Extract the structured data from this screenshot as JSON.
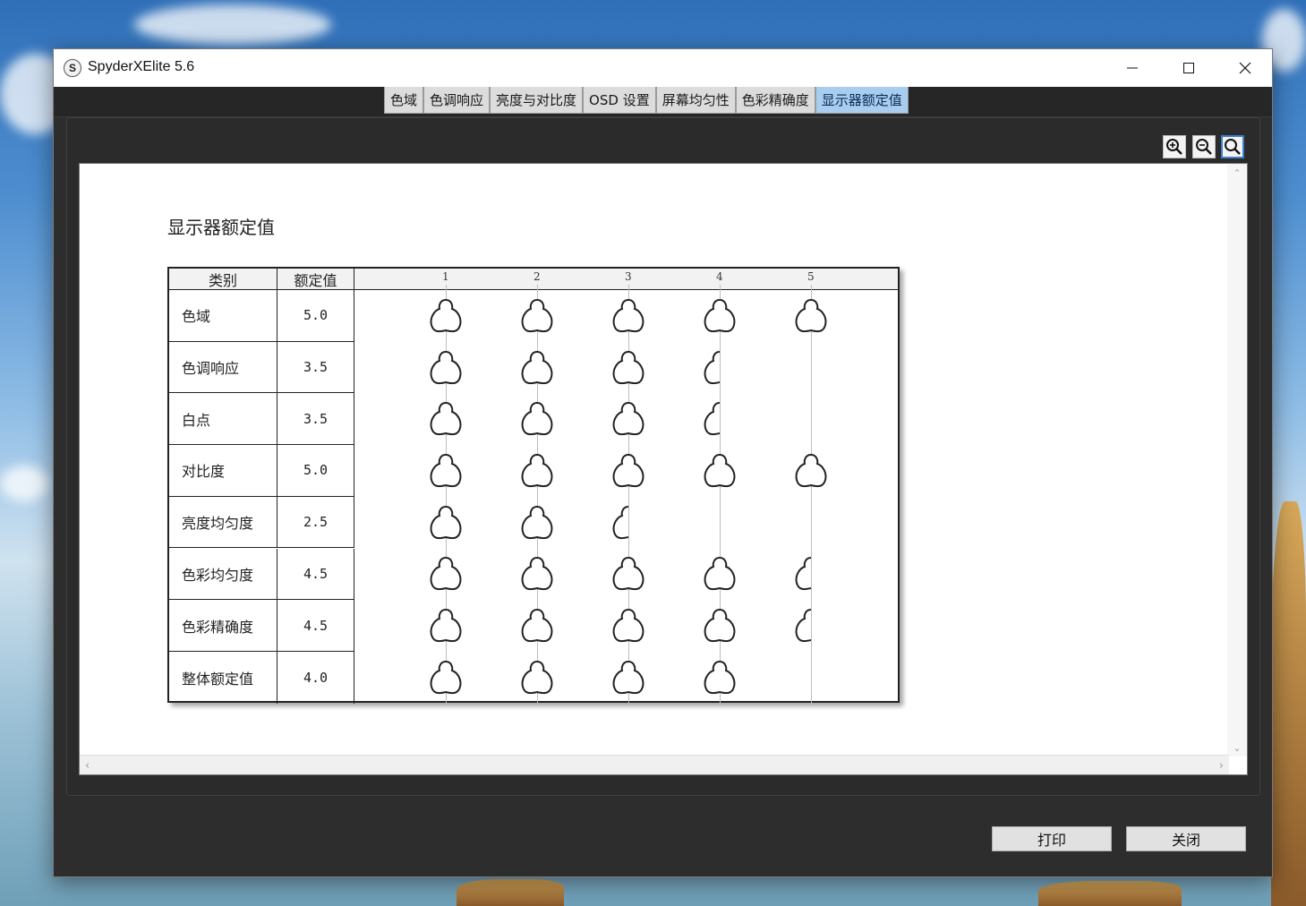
{
  "window": {
    "title": "SpyderXElite 5.6",
    "app_icon_letter": "S"
  },
  "tabs": [
    {
      "label": "色域",
      "active": false
    },
    {
      "label": "色调响应",
      "active": false
    },
    {
      "label": "亮度与对比度",
      "active": false
    },
    {
      "label": "OSD 设置",
      "active": false
    },
    {
      "label": "屏幕均匀性",
      "active": false
    },
    {
      "label": "色彩精确度",
      "active": false
    },
    {
      "label": "显示器额定值",
      "active": true
    }
  ],
  "zoom_tools": [
    "zoom-in-icon",
    "zoom-out-icon",
    "zoom-fit-icon"
  ],
  "report": {
    "title": "显示器额定值",
    "headers": {
      "category": "类别",
      "rating": "额定值",
      "scale": [
        "1",
        "2",
        "3",
        "4",
        "5"
      ]
    },
    "rows": [
      {
        "category": "色域",
        "rating": "5.0",
        "value": 5.0
      },
      {
        "category": "色调响应",
        "rating": "3.5",
        "value": 3.5
      },
      {
        "category": "白点",
        "rating": "3.5",
        "value": 3.5
      },
      {
        "category": "对比度",
        "rating": "5.0",
        "value": 5.0
      },
      {
        "category": "亮度均匀度",
        "rating": "2.5",
        "value": 2.5
      },
      {
        "category": "色彩均匀度",
        "rating": "4.5",
        "value": 4.5
      },
      {
        "category": "色彩精确度",
        "rating": "4.5",
        "value": 4.5
      },
      {
        "category": "整体额定值",
        "rating": "4.0",
        "value": 4.0
      }
    ]
  },
  "buttons": {
    "print": "打印",
    "close": "关闭"
  },
  "colors": {
    "active_tab": "#a9cdef",
    "window_bg": "#2d2d2d"
  }
}
